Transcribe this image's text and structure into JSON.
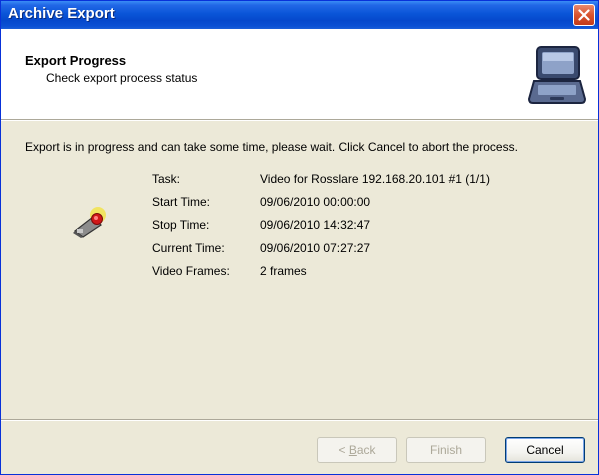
{
  "window": {
    "title": "Archive Export"
  },
  "header": {
    "title": "Export Progress",
    "subtitle": "Check export process status",
    "icon": "laptop-icon"
  },
  "body": {
    "intro": "Export is in progress and can take some time, please wait. Click Cancel to abort the process.",
    "task_icon": "camera-icon",
    "fields": [
      {
        "label": "Task:",
        "value": "Video for Rosslare 192.168.20.101 #1 (1/1)"
      },
      {
        "label": "Start Time:",
        "value": "09/06/2010 00:00:00"
      },
      {
        "label": "Stop Time:",
        "value": "09/06/2010 14:32:47"
      },
      {
        "label": "Current Time:",
        "value": "09/06/2010 07:27:27"
      },
      {
        "label": "Video Frames:",
        "value": "2 frames"
      }
    ]
  },
  "buttons": {
    "back_prefix": "< ",
    "back_accel": "B",
    "back_rest": "ack",
    "finish": "Finish",
    "cancel": "Cancel"
  },
  "colors": {
    "titlebar": "#0a55d8",
    "close": "#d8532e",
    "dialog_bg": "#ece9d8"
  }
}
